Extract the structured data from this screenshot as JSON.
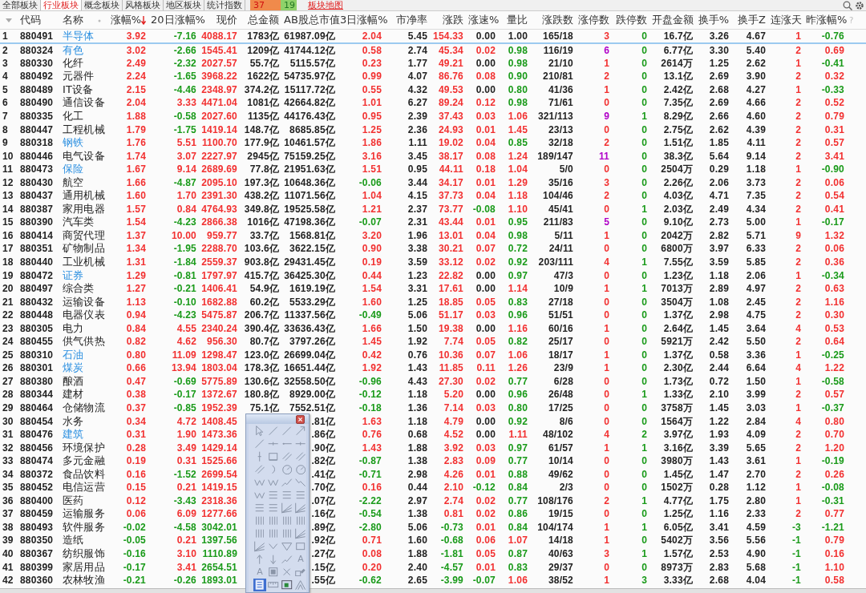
{
  "tabs": [
    {
      "label": "全部板块",
      "selected": false
    },
    {
      "label": "行业板块",
      "selected": true
    },
    {
      "label": "概念板块",
      "selected": false
    },
    {
      "label": "风格板块",
      "selected": false
    },
    {
      "label": "地区板块",
      "selected": false
    },
    {
      "label": "统计指数",
      "selected": false
    }
  ],
  "market_breadth": {
    "up": "37",
    "down": "19"
  },
  "map_link": "板块地图",
  "table": {
    "columns": [
      {
        "sorted": false
      },
      {
        "label": "代码",
        "sorted": false
      },
      {
        "label": "名称",
        "sorted": false
      },
      {
        "label": "涨幅%",
        "sorted": true
      },
      {
        "label": "20日涨幅%",
        "sorted": false
      },
      {
        "label": "现价",
        "sorted": false
      },
      {
        "label": "总金额",
        "sorted": false
      },
      {
        "label": "AB股总市值",
        "sorted": false
      },
      {
        "label": "3日涨幅%",
        "sorted": false
      },
      {
        "label": "市净率",
        "sorted": false
      },
      {
        "label": "涨跌",
        "sorted": false
      },
      {
        "label": "涨速%",
        "sorted": false
      },
      {
        "label": "量比",
        "sorted": false
      },
      {
        "label": "涨跌数",
        "sorted": false
      },
      {
        "label": "涨停数",
        "sorted": false
      },
      {
        "label": "跌停数",
        "sorted": false
      },
      {
        "label": "开盘金额",
        "sorted": false
      },
      {
        "label": "换手%",
        "sorted": false
      },
      {
        "label": "换手Z",
        "sorted": false
      },
      {
        "label": "连涨天",
        "sorted": false
      },
      {
        "label": "昨涨幅%",
        "sorted": false
      }
    ],
    "help_mark": "?",
    "rows": [
      {
        "selected": true,
        "highlight": true,
        "cells": [
          "1",
          "880491",
          "半导体",
          "3.92",
          "-7.16",
          "4088.17",
          "1783亿",
          "61987.09亿",
          "2.04",
          "5.45",
          "154.33",
          "0.00",
          "1.00",
          "165/18",
          "3",
          "0",
          "16.7亿",
          "3.26",
          "4.67",
          "1",
          "-0.76"
        ]
      },
      {
        "selected": false,
        "highlight": true,
        "cells": [
          "2",
          "880324",
          "有色",
          "3.02",
          "-2.66",
          "1545.41",
          "1209亿",
          "41744.12亿",
          "0.58",
          "2.74",
          "45.34",
          "0.02",
          "0.98",
          "116/19",
          "6",
          "0",
          "6.77亿",
          "3.30",
          "5.40",
          "2",
          "0.69"
        ]
      },
      {
        "selected": false,
        "highlight": false,
        "cells": [
          "3",
          "880330",
          "化纤",
          "2.49",
          "-2.32",
          "2027.57",
          "55.7亿",
          "5115.57亿",
          "0.23",
          "1.77",
          "49.21",
          "0.00",
          "0.98",
          "21/10",
          "1",
          "0",
          "2614万",
          "1.25",
          "2.62",
          "1",
          "-0.41"
        ]
      },
      {
        "selected": false,
        "highlight": false,
        "cells": [
          "4",
          "880492",
          "元器件",
          "2.24",
          "-1.65",
          "3968.22",
          "1622亿",
          "54735.97亿",
          "0.99",
          "4.07",
          "86.76",
          "0.08",
          "0.90",
          "210/81",
          "2",
          "0",
          "13.1亿",
          "2.69",
          "3.90",
          "2",
          "0.32"
        ]
      },
      {
        "selected": false,
        "highlight": false,
        "cells": [
          "5",
          "880489",
          "IT设备",
          "2.15",
          "-4.46",
          "2348.97",
          "374.2亿",
          "15117.72亿",
          "0.55",
          "4.32",
          "49.53",
          "0.00",
          "0.80",
          "41/36",
          "1",
          "0",
          "2.42亿",
          "2.68",
          "4.27",
          "1",
          "-0.33"
        ]
      },
      {
        "selected": false,
        "highlight": false,
        "cells": [
          "6",
          "880490",
          "通信设备",
          "2.04",
          "3.33",
          "4471.04",
          "1081亿",
          "42664.82亿",
          "1.01",
          "6.27",
          "89.24",
          "0.12",
          "0.98",
          "71/61",
          "0",
          "0",
          "7.35亿",
          "2.69",
          "4.66",
          "2",
          "0.52"
        ]
      },
      {
        "selected": false,
        "highlight": false,
        "cells": [
          "7",
          "880335",
          "化工",
          "1.88",
          "-0.58",
          "2027.60",
          "1135亿",
          "44176.43亿",
          "0.95",
          "2.39",
          "37.43",
          "0.03",
          "1.06",
          "321/113",
          "9",
          "1",
          "8.29亿",
          "2.66",
          "4.60",
          "2",
          "0.79"
        ]
      },
      {
        "selected": false,
        "highlight": false,
        "cells": [
          "8",
          "880447",
          "工程机械",
          "1.79",
          "-1.75",
          "1419.14",
          "148.7亿",
          "8685.85亿",
          "1.25",
          "2.36",
          "24.93",
          "0.01",
          "1.45",
          "23/13",
          "0",
          "0",
          "2.75亿",
          "2.62",
          "4.39",
          "2",
          "0.31"
        ]
      },
      {
        "selected": false,
        "highlight": true,
        "cells": [
          "9",
          "880318",
          "钢铁",
          "1.76",
          "5.51",
          "1100.70",
          "177.9亿",
          "10461.57亿",
          "1.86",
          "1.11",
          "19.02",
          "0.04",
          "0.85",
          "32/18",
          "2",
          "0",
          "1.51亿",
          "1.85",
          "4.11",
          "2",
          "0.57"
        ]
      },
      {
        "selected": false,
        "highlight": false,
        "cells": [
          "10",
          "880446",
          "电气设备",
          "1.74",
          "3.07",
          "2227.97",
          "2945亿",
          "75159.25亿",
          "3.16",
          "3.45",
          "38.17",
          "0.08",
          "1.24",
          "189/147",
          "11",
          "0",
          "38.3亿",
          "5.64",
          "9.14",
          "2",
          "3.41"
        ]
      },
      {
        "selected": false,
        "highlight": true,
        "cells": [
          "11",
          "880473",
          "保险",
          "1.67",
          "9.14",
          "2689.69",
          "77.8亿",
          "21951.63亿",
          "1.51",
          "0.95",
          "44.11",
          "0.18",
          "1.04",
          "5/0",
          "0",
          "0",
          "2504万",
          "0.29",
          "1.18",
          "1",
          "-0.90"
        ]
      },
      {
        "selected": false,
        "highlight": false,
        "cells": [
          "12",
          "880430",
          "航空",
          "1.66",
          "-4.87",
          "2095.10",
          "197.3亿",
          "10648.36亿",
          "-0.06",
          "3.44",
          "34.17",
          "0.01",
          "1.29",
          "35/16",
          "3",
          "0",
          "2.26亿",
          "2.06",
          "3.73",
          "2",
          "0.06"
        ]
      },
      {
        "selected": false,
        "highlight": false,
        "cells": [
          "13",
          "880437",
          "通用机械",
          "1.60",
          "1.70",
          "2391.30",
          "438.2亿",
          "11071.56亿",
          "1.04",
          "4.15",
          "37.73",
          "0.04",
          "1.18",
          "104/46",
          "2",
          "0",
          "4.03亿",
          "4.71",
          "7.35",
          "2",
          "0.54"
        ]
      },
      {
        "selected": false,
        "highlight": false,
        "cells": [
          "14",
          "880387",
          "家用电器",
          "1.57",
          "0.84",
          "4764.93",
          "349.8亿",
          "19525.58亿",
          "1.21",
          "2.37",
          "73.77",
          "-0.08",
          "1.10",
          "45/41",
          "0",
          "1",
          "2.03亿",
          "2.49",
          "4.34",
          "2",
          "0.41"
        ]
      },
      {
        "selected": false,
        "highlight": false,
        "cells": [
          "15",
          "880390",
          "汽车类",
          "1.54",
          "-4.23",
          "2866.38",
          "1016亿",
          "47198.36亿",
          "-0.07",
          "2.31",
          "43.44",
          "0.01",
          "0.95",
          "211/83",
          "5",
          "0",
          "9.10亿",
          "2.73",
          "5.00",
          "1",
          "-0.17"
        ]
      },
      {
        "selected": false,
        "highlight": false,
        "cells": [
          "16",
          "880414",
          "商贸代理",
          "1.37",
          "10.00",
          "959.77",
          "33.7亿",
          "1568.81亿",
          "3.20",
          "1.96",
          "13.01",
          "0.04",
          "0.98",
          "5/11",
          "1",
          "0",
          "2042万",
          "2.82",
          "5.71",
          "9",
          "1.32"
        ]
      },
      {
        "selected": false,
        "highlight": false,
        "cells": [
          "17",
          "880351",
          "矿物制品",
          "1.34",
          "-1.95",
          "2288.70",
          "103.6亿",
          "3622.15亿",
          "0.90",
          "3.38",
          "30.21",
          "0.07",
          "0.72",
          "24/11",
          "0",
          "0",
          "6800万",
          "3.97",
          "6.33",
          "2",
          "0.06"
        ]
      },
      {
        "selected": false,
        "highlight": false,
        "cells": [
          "18",
          "880440",
          "工业机械",
          "1.31",
          "-1.84",
          "2559.37",
          "903.8亿",
          "29431.45亿",
          "0.19",
          "3.59",
          "33.12",
          "0.02",
          "0.92",
          "203/111",
          "4",
          "1",
          "7.55亿",
          "3.59",
          "5.85",
          "2",
          "0.36"
        ]
      },
      {
        "selected": false,
        "highlight": true,
        "cells": [
          "19",
          "880472",
          "证券",
          "1.29",
          "-0.81",
          "1797.97",
          "415.7亿",
          "36425.30亿",
          "0.44",
          "1.23",
          "22.82",
          "0.00",
          "0.97",
          "47/3",
          "0",
          "0",
          "1.23亿",
          "1.18",
          "2.06",
          "1",
          "-0.34"
        ]
      },
      {
        "selected": false,
        "highlight": false,
        "cells": [
          "20",
          "880497",
          "综合类",
          "1.27",
          "-0.21",
          "1406.41",
          "54.9亿",
          "1619.19亿",
          "1.54",
          "3.31",
          "17.61",
          "0.00",
          "1.14",
          "10/9",
          "1",
          "1",
          "7013万",
          "2.89",
          "4.97",
          "2",
          "0.63"
        ]
      },
      {
        "selected": false,
        "highlight": false,
        "cells": [
          "21",
          "880432",
          "运输设备",
          "1.13",
          "-0.10",
          "1682.88",
          "60.2亿",
          "5533.29亿",
          "1.60",
          "1.25",
          "18.85",
          "0.05",
          "0.83",
          "27/18",
          "0",
          "0",
          "3504万",
          "1.08",
          "2.45",
          "2",
          "1.16"
        ]
      },
      {
        "selected": false,
        "highlight": false,
        "cells": [
          "22",
          "880448",
          "电器仪表",
          "0.94",
          "-4.23",
          "5475.87",
          "206.7亿",
          "11337.56亿",
          "-0.49",
          "5.06",
          "51.17",
          "0.03",
          "0.96",
          "51/51",
          "0",
          "0",
          "1.37亿",
          "2.98",
          "4.75",
          "2",
          "0.30"
        ]
      },
      {
        "selected": false,
        "highlight": false,
        "cells": [
          "23",
          "880305",
          "电力",
          "0.84",
          "4.55",
          "2340.24",
          "390.4亿",
          "33636.43亿",
          "1.66",
          "1.50",
          "19.38",
          "0.00",
          "1.16",
          "60/16",
          "1",
          "0",
          "2.64亿",
          "1.45",
          "3.64",
          "4",
          "0.53"
        ]
      },
      {
        "selected": false,
        "highlight": false,
        "cells": [
          "24",
          "880455",
          "供气供热",
          "0.82",
          "4.62",
          "956.30",
          "80.7亿",
          "3797.26亿",
          "1.45",
          "1.92",
          "7.74",
          "0.05",
          "0.82",
          "25/17",
          "0",
          "0",
          "5921万",
          "2.42",
          "5.50",
          "2",
          "0.64"
        ]
      },
      {
        "selected": false,
        "highlight": true,
        "cells": [
          "25",
          "880310",
          "石油",
          "0.80",
          "11.09",
          "1298.47",
          "123.0亿",
          "26699.04亿",
          "0.42",
          "0.76",
          "10.36",
          "0.07",
          "1.06",
          "18/17",
          "1",
          "0",
          "1.37亿",
          "0.58",
          "3.36",
          "1",
          "-0.25"
        ]
      },
      {
        "selected": false,
        "highlight": true,
        "cells": [
          "26",
          "880301",
          "煤炭",
          "0.66",
          "13.94",
          "1803.04",
          "178.3亿",
          "16651.44亿",
          "1.92",
          "1.43",
          "11.85",
          "0.11",
          "1.26",
          "23/9",
          "1",
          "0",
          "2.30亿",
          "2.44",
          "6.64",
          "4",
          "1.22"
        ]
      },
      {
        "selected": false,
        "highlight": false,
        "cells": [
          "27",
          "880380",
          "酿酒",
          "0.47",
          "-0.69",
          "5775.89",
          "130.6亿",
          "32558.50亿",
          "-0.96",
          "4.43",
          "27.30",
          "0.02",
          "0.77",
          "6/28",
          "0",
          "0",
          "1.73亿",
          "0.72",
          "1.50",
          "1",
          "-0.58"
        ]
      },
      {
        "selected": false,
        "highlight": false,
        "cells": [
          "28",
          "880344",
          "建材",
          "0.38",
          "-0.17",
          "1372.67",
          "180.8亿",
          "8929.00亿",
          "-0.12",
          "1.18",
          "5.20",
          "0.00",
          "0.96",
          "26/48",
          "0",
          "1",
          "1.33亿",
          "2.10",
          "3.99",
          "2",
          "0.57"
        ]
      },
      {
        "selected": false,
        "highlight": false,
        "cells": [
          "29",
          "880464",
          "仓储物流",
          "0.37",
          "-0.85",
          "1952.39",
          "75.1亿",
          "7552.51亿",
          "-0.18",
          "1.36",
          "7.14",
          "0.03",
          "0.80",
          "17/25",
          "0",
          "0",
          "3758万",
          "1.45",
          "3.03",
          "1",
          "-0.37"
        ]
      },
      {
        "selected": false,
        "highlight": false,
        "cells": [
          "30",
          "880454",
          "水务",
          "0.34",
          "4.72",
          "1408.45",
          null,
          ".81亿",
          "1.63",
          "1.18",
          "4.79",
          "0.00",
          "0.92",
          "8/6",
          "0",
          "0",
          "1564万",
          "1.22",
          "2.84",
          "4",
          "0.80"
        ]
      },
      {
        "selected": false,
        "highlight": true,
        "cells": [
          "31",
          "880476",
          "建筑",
          "0.31",
          "1.90",
          "1473.36",
          null,
          ".86亿",
          "0.76",
          "0.68",
          "4.52",
          "0.00",
          "1.11",
          "48/102",
          "4",
          "2",
          "3.97亿",
          "1.93",
          "4.09",
          "2",
          "0.70"
        ]
      },
      {
        "selected": false,
        "highlight": false,
        "cells": [
          "32",
          "880456",
          "环境保护",
          "0.28",
          "3.49",
          "1429.14",
          null,
          ".90亿",
          "1.43",
          "1.88",
          "3.92",
          "0.03",
          "0.97",
          "61/57",
          "1",
          "1",
          "3.16亿",
          "3.39",
          "5.65",
          "2",
          "1.20"
        ]
      },
      {
        "selected": false,
        "highlight": false,
        "cells": [
          "33",
          "880474",
          "多元金融",
          "0.19",
          "0.31",
          "1525.66",
          null,
          ".82亿",
          "-0.87",
          "1.38",
          "2.83",
          "0.09",
          "0.77",
          "10/14",
          "0",
          "0",
          "3980万",
          "1.43",
          "3.61",
          "1",
          "-0.19"
        ]
      },
      {
        "selected": false,
        "highlight": false,
        "cells": [
          "34",
          "880372",
          "食品饮料",
          "0.16",
          "-1.52",
          "2699.54",
          null,
          ".41亿",
          "-0.71",
          "2.98",
          "4.26",
          "0.01",
          "0.88",
          "49/62",
          "0",
          "0",
          "1.45亿",
          "1.47",
          "2.70",
          "2",
          "0.26"
        ]
      },
      {
        "selected": false,
        "highlight": false,
        "cells": [
          "35",
          "880452",
          "电信运营",
          "0.15",
          "0.21",
          "1419.15",
          null,
          ".70亿",
          "0.16",
          "0.44",
          "2.10",
          "-0.12",
          "0.84",
          "2/3",
          "0",
          "0",
          "1502万",
          "0.28",
          "1.12",
          "1",
          "-0.08"
        ]
      },
      {
        "selected": false,
        "highlight": false,
        "cells": [
          "36",
          "880400",
          "医药",
          "0.12",
          "-3.43",
          "2318.36",
          null,
          ".07亿",
          "-2.22",
          "2.97",
          "2.74",
          "0.02",
          "0.77",
          "108/176",
          "2",
          "1",
          "4.77亿",
          "1.75",
          "2.80",
          "1",
          "-0.31"
        ]
      },
      {
        "selected": false,
        "highlight": false,
        "cells": [
          "37",
          "880459",
          "运输服务",
          "0.06",
          "6.09",
          "1277.66",
          null,
          ".16亿",
          "-0.54",
          "1.38",
          "0.81",
          "0.02",
          "0.86",
          "19/15",
          "0",
          "0",
          "1.25亿",
          "1.16",
          "2.33",
          "2",
          "0.77"
        ]
      },
      {
        "selected": false,
        "highlight": false,
        "cells": [
          "38",
          "880493",
          "软件服务",
          "-0.02",
          "-4.58",
          "3042.01",
          null,
          ".89亿",
          "-2.80",
          "5.06",
          "-0.73",
          "0.01",
          "0.84",
          "104/174",
          "1",
          "1",
          "6.05亿",
          "3.41",
          "4.59",
          "-3",
          "-1.21"
        ]
      },
      {
        "selected": false,
        "highlight": false,
        "cells": [
          "39",
          "880350",
          "造纸",
          "-0.05",
          "0.21",
          "1397.56",
          null,
          ".92亿",
          "0.71",
          "1.60",
          "-0.68",
          "0.06",
          "1.07",
          "14/18",
          "1",
          "0",
          "5402万",
          "3.56",
          "5.56",
          "-1",
          "0.79"
        ]
      },
      {
        "selected": false,
        "highlight": false,
        "cells": [
          "40",
          "880367",
          "纺织服饰",
          "-0.16",
          "3.10",
          "1110.89",
          null,
          ".27亿",
          "0.08",
          "1.88",
          "-1.81",
          "0.05",
          "0.87",
          "40/63",
          "3",
          "1",
          "1.57亿",
          "2.53",
          "4.90",
          "-1",
          "0.16"
        ]
      },
      {
        "selected": false,
        "highlight": false,
        "cells": [
          "41",
          "880399",
          "家居用品",
          "-0.17",
          "3.41",
          "2654.51",
          null,
          ".15亿",
          "0.20",
          "2.40",
          "-4.57",
          "0.01",
          "0.83",
          "29/37",
          "0",
          "0",
          "8973万",
          "2.83",
          "5.68",
          "-1",
          "1.10"
        ]
      },
      {
        "selected": false,
        "highlight": false,
        "cells": [
          "42",
          "880360",
          "农林牧渔",
          "-0.21",
          "-0.26",
          "1893.01",
          null,
          ".55亿",
          "-0.62",
          "2.65",
          "-3.99",
          "-0.07",
          "1.06",
          "38/52",
          "1",
          "3",
          "3.33亿",
          "2.68",
          "4.04",
          "-1",
          "0.58"
        ]
      }
    ]
  },
  "toolbar": {
    "tools": [
      {
        "kind": "cursor",
        "selected": false
      },
      {
        "kind": "line",
        "selected": false
      },
      {
        "kind": "line",
        "selected": false
      },
      {
        "kind": "arrow",
        "selected": false
      },
      {
        "kind": "line",
        "selected": false
      },
      {
        "kind": "segment",
        "selected": false
      },
      {
        "kind": "ray",
        "selected": false
      },
      {
        "kind": "segment",
        "selected": false
      },
      {
        "kind": "vline",
        "selected": false
      },
      {
        "kind": "box",
        "selected": false
      },
      {
        "kind": "parallel",
        "selected": false
      },
      {
        "kind": "parallel",
        "selected": false
      },
      {
        "kind": "parallel",
        "selected": false
      },
      {
        "kind": "arc",
        "selected": false
      },
      {
        "kind": "circle",
        "selected": false
      },
      {
        "kind": "circle",
        "selected": false
      },
      {
        "kind": "wave",
        "selected": false
      },
      {
        "kind": "wave",
        "selected": false
      },
      {
        "kind": "rise",
        "selected": false
      },
      {
        "kind": "fall",
        "selected": false
      },
      {
        "kind": "wave",
        "selected": false
      },
      {
        "kind": "hlines",
        "selected": false
      },
      {
        "kind": "hlines",
        "selected": false
      },
      {
        "kind": "hlines",
        "selected": false
      },
      {
        "kind": "hlines",
        "selected": false
      },
      {
        "kind": "hlines",
        "selected": false
      },
      {
        "kind": "fan",
        "selected": false
      },
      {
        "kind": "fan",
        "selected": false
      },
      {
        "kind": "vlines",
        "selected": false
      },
      {
        "kind": "vlines",
        "selected": false
      },
      {
        "kind": "vlines",
        "selected": false
      },
      {
        "kind": "vlines",
        "selected": false
      },
      {
        "kind": "vlines",
        "selected": false
      },
      {
        "kind": "vlines",
        "selected": false
      },
      {
        "kind": "vlines",
        "selected": false
      },
      {
        "kind": "fan",
        "selected": false
      },
      {
        "kind": "fan",
        "selected": false
      },
      {
        "kind": "chevron",
        "selected": false
      },
      {
        "kind": "triangle",
        "selected": false
      },
      {
        "kind": "rect",
        "selected": false
      },
      {
        "kind": "uparrow",
        "selected": false
      },
      {
        "kind": "downarrow",
        "selected": false
      },
      {
        "kind": "rise",
        "selected": false
      },
      {
        "kind": "text",
        "label": "A",
        "selected": false
      },
      {
        "kind": "text",
        "label": "A",
        "selected": false
      },
      {
        "kind": "square",
        "selected": false
      },
      {
        "kind": "cross",
        "selected": false
      },
      {
        "kind": "eraser",
        "selected": false
      },
      {
        "kind": "list",
        "selected": true
      },
      {
        "kind": "ruler",
        "selected": false
      },
      {
        "kind": "card",
        "selected": false
      },
      {
        "kind": "peak",
        "selected": false
      }
    ]
  }
}
